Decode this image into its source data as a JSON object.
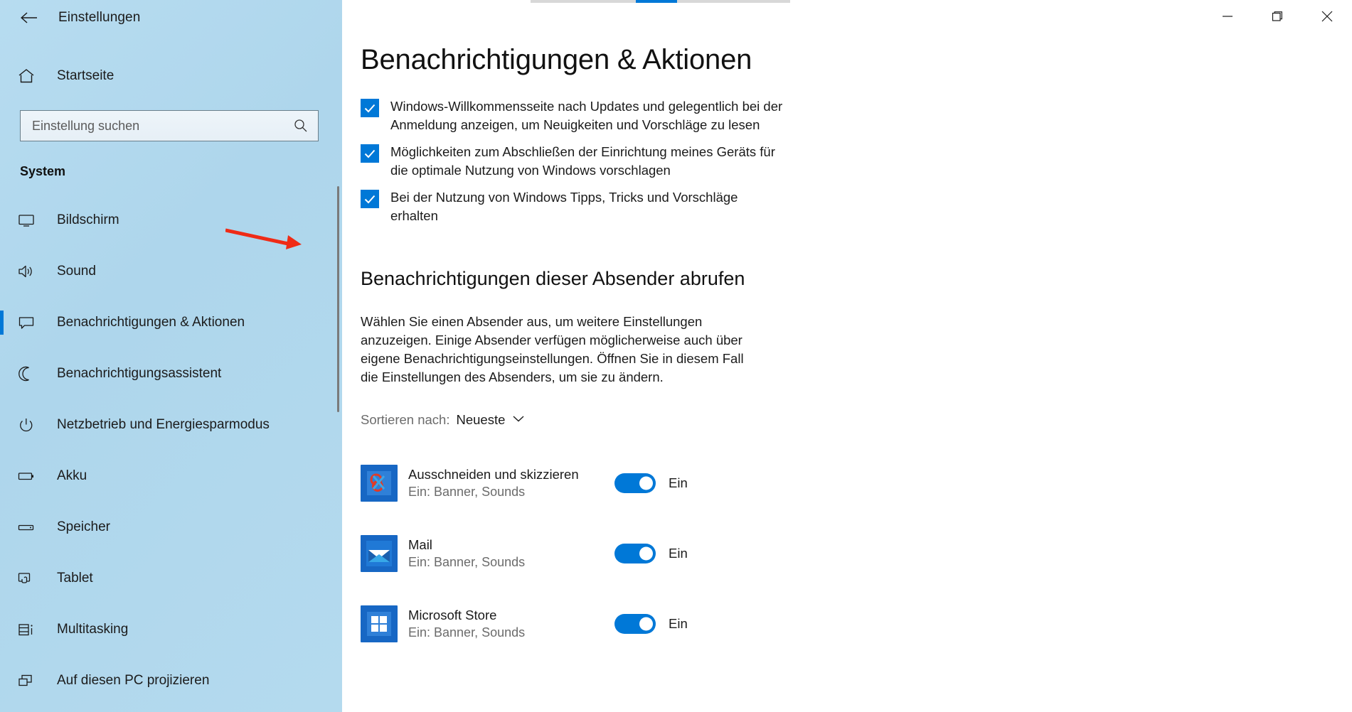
{
  "window": {
    "title": "Einstellungen",
    "back_icon": "back-arrow-icon",
    "minimize_label": "–",
    "maximize_label": "❐",
    "close_label": "✕"
  },
  "sidebar": {
    "home_label": "Startseite",
    "home_icon": "home-icon",
    "search": {
      "placeholder": "Einstellung suchen",
      "value": "",
      "icon": "search-icon"
    },
    "group_title": "System",
    "items": [
      {
        "label": "Bildschirm",
        "icon": "monitor-icon",
        "selected": false
      },
      {
        "label": "Sound",
        "icon": "speaker-icon",
        "selected": false
      },
      {
        "label": "Benachrichtigungen & Aktionen",
        "icon": "chat-bubble-icon",
        "selected": true
      },
      {
        "label": "Benachrichtigungsassistent",
        "icon": "moon-icon",
        "selected": false
      },
      {
        "label": "Netzbetrieb und Energiesparmodus",
        "icon": "power-icon",
        "selected": false
      },
      {
        "label": "Akku",
        "icon": "battery-icon",
        "selected": false
      },
      {
        "label": "Speicher",
        "icon": "storage-icon",
        "selected": false
      },
      {
        "label": "Tablet",
        "icon": "tablet-icon",
        "selected": false
      },
      {
        "label": "Multitasking",
        "icon": "multitasking-icon",
        "selected": false
      },
      {
        "label": "Auf diesen PC projizieren",
        "icon": "project-icon",
        "selected": false
      }
    ]
  },
  "main": {
    "page_title": "Benachrichtigungen & Aktionen",
    "checkboxes": [
      {
        "label": "Windows-Willkommensseite nach Updates und gelegentlich bei der Anmeldung anzeigen, um Neuigkeiten und Vorschläge zu lesen",
        "checked": true
      },
      {
        "label": "Möglichkeiten zum Abschließen der Einrichtung meines Geräts für die optimale Nutzung von Windows vorschlagen",
        "checked": true
      },
      {
        "label": "Bei der Nutzung von Windows Tipps, Tricks und Vorschläge erhalten",
        "checked": true
      }
    ],
    "section_heading": "Benachrichtigungen dieser Absender abrufen",
    "section_description": "Wählen Sie einen Absender aus, um weitere Einstellungen anzuzeigen. Einige Absender verfügen möglicherweise auch über eigene Benachrichtigungseinstellungen. Öffnen Sie in diesem Fall die Einstellungen des Absenders, um sie zu ändern.",
    "sort": {
      "prefix": "Sortieren nach:",
      "value": "Neueste",
      "chevron_icon": "chevron-down-icon"
    },
    "apps": [
      {
        "name": "Ausschneiden und skizzieren",
        "state": "Ein: Banner, Sounds",
        "toggle_on": true,
        "toggle_label": "Ein",
        "icon": "snip-sketch-icon"
      },
      {
        "name": "Mail",
        "state": "Ein: Banner, Sounds",
        "toggle_on": true,
        "toggle_label": "Ein",
        "icon": "mail-icon"
      },
      {
        "name": "Microsoft Store",
        "state": "Ein: Banner, Sounds",
        "toggle_on": true,
        "toggle_label": "Ein",
        "icon": "microsoft-store-icon"
      }
    ]
  },
  "annotation": {
    "arrow_color": "#ef2b16",
    "arrow_target": "Benachrichtigungen dieser Absender abrufen"
  },
  "colors": {
    "accent": "#0078d7",
    "sidebar_bg": "#b2d9ef",
    "text": "#1b1b1b",
    "muted_text": "#6b6b6b"
  }
}
